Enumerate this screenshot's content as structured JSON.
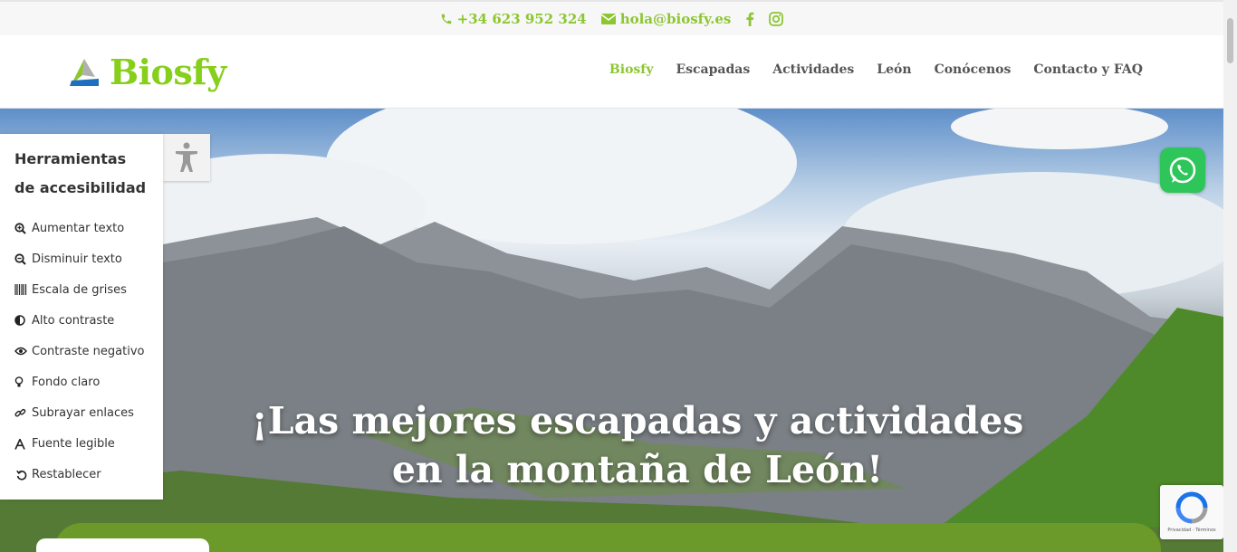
{
  "topbar": {
    "phone": "+34 623 952 324",
    "email": "hola@biosfy.es",
    "icons": [
      "phone-icon",
      "mail-icon",
      "facebook-icon",
      "instagram-icon"
    ]
  },
  "header": {
    "brand": "Biosfy",
    "nav": [
      {
        "label": "Biosfy",
        "active": true
      },
      {
        "label": "Escapadas",
        "active": false
      },
      {
        "label": "Actividades",
        "active": false
      },
      {
        "label": "León",
        "active": false
      },
      {
        "label": "Conócenos",
        "active": false
      },
      {
        "label": "Contacto y FAQ",
        "active": false
      }
    ]
  },
  "hero": {
    "headline_line1": "¡Las mejores escapadas y actividades",
    "headline_line2": "en la montaña de León!"
  },
  "accessibility": {
    "title": "Herramientas de accesibilidad",
    "items": [
      {
        "label": "Aumentar texto",
        "icon": "zoom-in-icon"
      },
      {
        "label": "Disminuir texto",
        "icon": "zoom-out-icon"
      },
      {
        "label": "Escala de grises",
        "icon": "barcode-icon"
      },
      {
        "label": "Alto contraste",
        "icon": "contrast-icon"
      },
      {
        "label": "Contraste negativo",
        "icon": "eye-icon"
      },
      {
        "label": "Fondo claro",
        "icon": "lightbulb-icon"
      },
      {
        "label": "Subrayar enlaces",
        "icon": "link-icon"
      },
      {
        "label": "Fuente legible",
        "icon": "font-icon"
      },
      {
        "label": "Restablecer",
        "icon": "reset-icon"
      }
    ]
  },
  "recaptcha": {
    "terms": "Privacidad - Términos"
  },
  "colors": {
    "accent": "#8cc630",
    "whatsapp": "#2ec55a",
    "hero_bar": "#6b9a2a"
  }
}
